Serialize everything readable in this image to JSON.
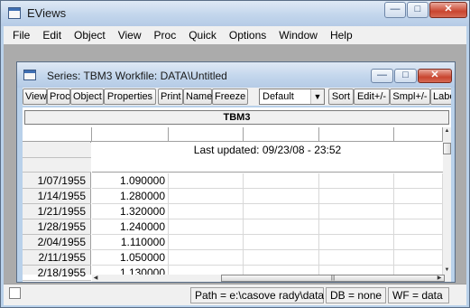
{
  "app": {
    "title": "EViews",
    "controls": {
      "minimize": "—",
      "maximize": "□",
      "close": "✕"
    }
  },
  "menu": [
    "File",
    "Edit",
    "Object",
    "View",
    "Proc",
    "Quick",
    "Options",
    "Window",
    "Help"
  ],
  "series_window": {
    "title": "Series: TBM3   Workfile: DATA\\Untitled",
    "controls": {
      "minimize": "—",
      "maximize": "□",
      "close": "✕"
    },
    "toolbar": {
      "buttons": [
        "View",
        "Proc",
        "Object",
        "Properties",
        "Print",
        "Name",
        "Freeze",
        "Sort",
        "Edit+/-",
        "Smpl+/-",
        "Label"
      ],
      "format_select": "Default"
    },
    "series_name": "TBM3",
    "last_updated": "Last updated: 09/23/08 - 23:52",
    "rows": [
      {
        "date": "1/07/1955",
        "value": "1.090000"
      },
      {
        "date": "1/14/1955",
        "value": "1.280000"
      },
      {
        "date": "1/21/1955",
        "value": "1.320000"
      },
      {
        "date": "1/28/1955",
        "value": "1.240000"
      },
      {
        "date": "2/04/1955",
        "value": "1.110000"
      },
      {
        "date": "2/11/1955",
        "value": "1.050000"
      },
      {
        "date": "2/18/1955",
        "value": "1.130000"
      }
    ]
  },
  "status": {
    "path": "Path = e:\\casove rady\\data",
    "db": "DB = none",
    "wf": "WF = data"
  },
  "icons": [
    "app-window-icon",
    "series-window-icon",
    "dropdown-arrow-icon",
    "scroll-up-icon",
    "scroll-down-icon",
    "scroll-left-icon",
    "scroll-right-icon"
  ]
}
